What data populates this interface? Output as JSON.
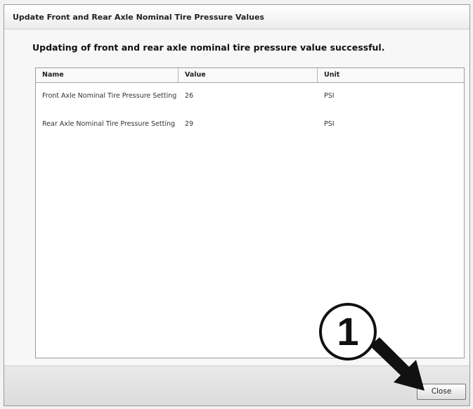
{
  "window": {
    "title": "Update Front and Rear Axle Nominal Tire Pressure Values"
  },
  "message": "Updating of front and rear axle nominal tire pressure value successful.",
  "table": {
    "headers": [
      "Name",
      "Value",
      "Unit"
    ],
    "rows": [
      {
        "name": "Front Axle Nominal Tire Pressure Setting",
        "value": "26",
        "unit": "PSI"
      },
      {
        "name": "Rear Axle Nominal Tire Pressure Setting",
        "value": "29",
        "unit": "PSI"
      }
    ]
  },
  "footer": {
    "close_label": "Close"
  },
  "callout": {
    "number": "1"
  }
}
